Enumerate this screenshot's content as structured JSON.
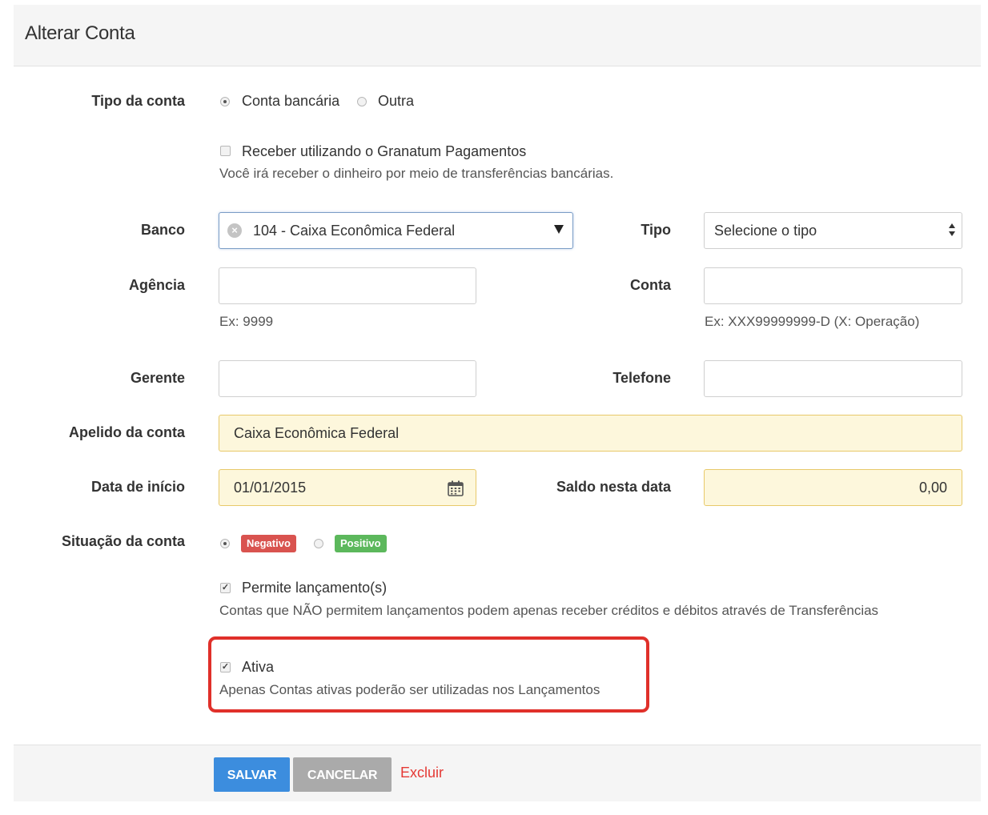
{
  "header": {
    "title": "Alterar Conta"
  },
  "tipo_conta": {
    "label": "Tipo da conta",
    "option_bancaria": "Conta bancária",
    "option_outra": "Outra",
    "selected": "Conta bancária"
  },
  "granatum": {
    "label": "Receber utilizando o Granatum Pagamentos",
    "help": "Você irá receber o dinheiro por meio de transferências bancárias.",
    "checked": false
  },
  "banco": {
    "label": "Banco",
    "value": "104 - Caixa Econômica Federal",
    "clear_icon": "clear-icon",
    "arrow_icon": "dropdown-arrow-icon"
  },
  "tipo": {
    "label": "Tipo",
    "value": "Selecione o tipo",
    "arrow_icon": "select-updown-icon"
  },
  "agencia": {
    "label": "Agência",
    "value": "",
    "help": "Ex: 9999"
  },
  "conta": {
    "label": "Conta",
    "value": "",
    "help": "Ex: XXX99999999-D (X: Operação)"
  },
  "gerente": {
    "label": "Gerente",
    "value": ""
  },
  "telefone": {
    "label": "Telefone",
    "value": ""
  },
  "apelido": {
    "label": "Apelido da conta",
    "value": "Caixa Econômica Federal"
  },
  "data_inicio": {
    "label": "Data de início",
    "value": "01/01/2015",
    "icon": "calendar-icon"
  },
  "saldo": {
    "label": "Saldo nesta data",
    "value": "0,00"
  },
  "situacao": {
    "label": "Situação da conta",
    "negativo": "Negativo",
    "positivo": "Positivo",
    "selected": "Negativo"
  },
  "permite": {
    "label": "Permite lançamento(s)",
    "help": "Contas que NÃO permitem lançamentos podem apenas receber créditos e débitos através de Transferências",
    "checked": true
  },
  "ativa": {
    "label": "Ativa",
    "help": "Apenas Contas ativas poderão ser utilizadas nos Lançamentos",
    "checked": true
  },
  "footer": {
    "save": "SALVAR",
    "cancel": "CANCELAR",
    "delete": "Excluir"
  },
  "colors": {
    "negative_badge": "#d9534f",
    "positive_badge": "#5cb85c",
    "save_button": "#3c8dde",
    "cancel_button": "#aaaaaa",
    "delete_link": "#e53935",
    "highlight_box": "#e0302a",
    "yellow_field": "#fdf7dc"
  }
}
